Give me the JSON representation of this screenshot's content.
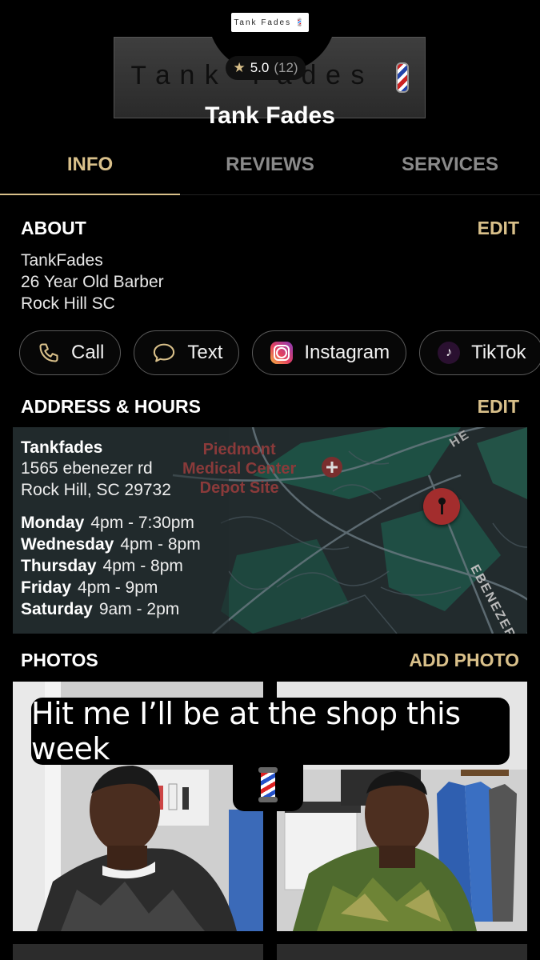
{
  "header": {
    "badge_text": "Tank Fades",
    "cover_text": "Tank Fades",
    "rating_value": "5.0",
    "rating_count": "(12)",
    "title": "Tank Fades"
  },
  "tabs": [
    {
      "label": "INFO",
      "active": true
    },
    {
      "label": "REVIEWS",
      "active": false
    },
    {
      "label": "SERVICES",
      "active": false
    }
  ],
  "about": {
    "title": "ABOUT",
    "action": "EDIT",
    "lines": [
      "TankFades",
      "26 Year Old Barber",
      "Rock Hill SC"
    ]
  },
  "contact_chips": [
    {
      "label": "Call",
      "icon": "phone-icon"
    },
    {
      "label": "Text",
      "icon": "chat-bubble-icon"
    },
    {
      "label": "Instagram",
      "icon": "instagram-icon"
    },
    {
      "label": "TikTok",
      "icon": "tiktok-icon"
    }
  ],
  "address": {
    "title": "ADDRESS & HOURS",
    "action": "EDIT",
    "name": "Tankfades",
    "street": "1565 ebenezer rd",
    "city": "Rock Hill, SC 29732",
    "hours": [
      {
        "day": "Monday",
        "time": "4pm - 7:30pm"
      },
      {
        "day": "Wednesday",
        "time": "4pm - 8pm"
      },
      {
        "day": "Thursday",
        "time": "4pm - 8pm"
      },
      {
        "day": "Friday",
        "time": "4pm - 9pm"
      },
      {
        "day": "Saturday",
        "time": "9am - 2pm"
      }
    ],
    "map_poi_lines": [
      "Piedmont",
      "Medical Center",
      "Depot Site"
    ],
    "map_street_top": "HE",
    "map_street_right": "EBENEZER"
  },
  "photos": {
    "title": "PHOTOS",
    "action": "ADD PHOTO"
  },
  "story_overlay": {
    "text": "Hit me I’ll be at the shop this week"
  },
  "colors": {
    "accent": "#d9c08a",
    "background": "#000000",
    "inactive_tab": "#8a8a8a"
  }
}
